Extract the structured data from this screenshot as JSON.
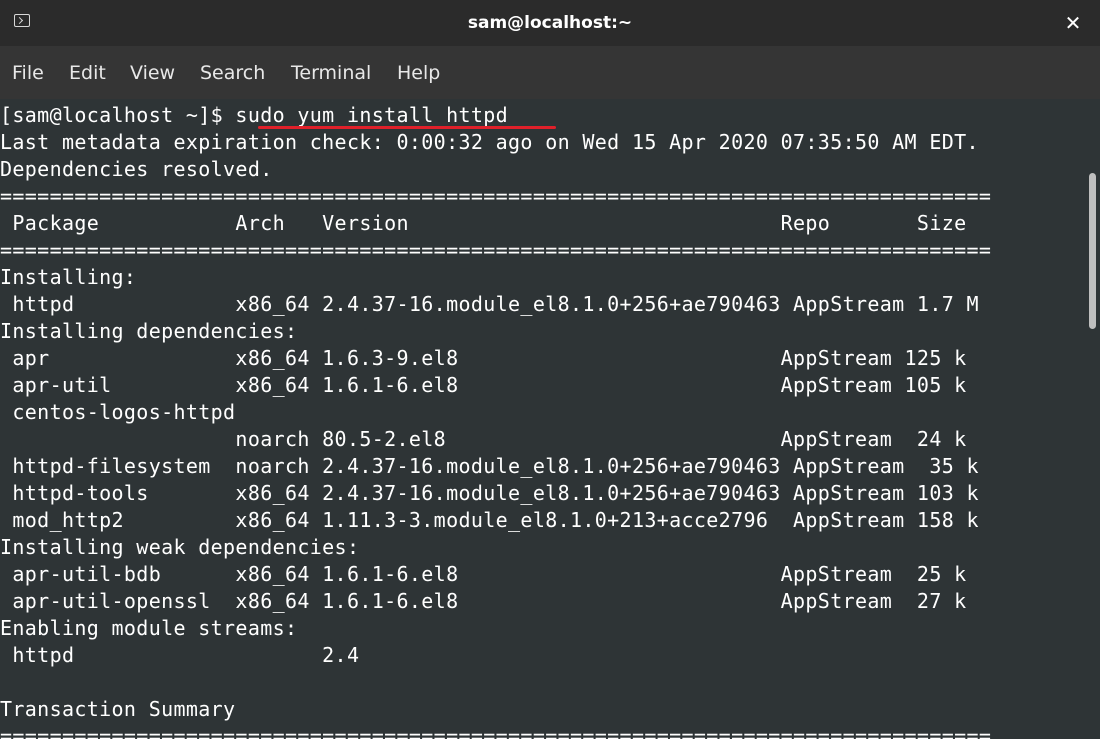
{
  "window": {
    "title": "sam@localhost:~",
    "close_glyph": "✕",
    "icon": "terminal-icon"
  },
  "menu": [
    "File",
    "Edit",
    "View",
    "Search",
    "Terminal",
    "Help"
  ],
  "terminal": {
    "lines": [
      "[sam@localhost ~]$ sudo yum install httpd",
      "Last metadata expiration check: 0:00:32 ago on Wed 15 Apr 2020 07:35:50 AM EDT.",
      "Dependencies resolved.",
      "================================================================================",
      " Package           Arch   Version                              Repo       Size",
      "================================================================================",
      "Installing:",
      " httpd             x86_64 2.4.37-16.module_el8.1.0+256+ae790463 AppStream 1.7 M",
      "Installing dependencies:",
      " apr               x86_64 1.6.3-9.el8                          AppStream 125 k",
      " apr-util          x86_64 1.6.1-6.el8                          AppStream 105 k",
      " centos-logos-httpd",
      "                   noarch 80.5-2.el8                           AppStream  24 k",
      " httpd-filesystem  noarch 2.4.37-16.module_el8.1.0+256+ae790463 AppStream  35 k",
      " httpd-tools       x86_64 2.4.37-16.module_el8.1.0+256+ae790463 AppStream 103 k",
      " mod_http2         x86_64 1.11.3-3.module_el8.1.0+213+acce2796  AppStream 158 k",
      "Installing weak dependencies:",
      " apr-util-bdb      x86_64 1.6.1-6.el8                          AppStream  25 k",
      " apr-util-openssl  x86_64 1.6.1-6.el8                          AppStream  27 k",
      "Enabling module streams:",
      " httpd                    2.4",
      "",
      "Transaction Summary",
      "================================================================================"
    ],
    "highlight_color": "#e0202a"
  }
}
